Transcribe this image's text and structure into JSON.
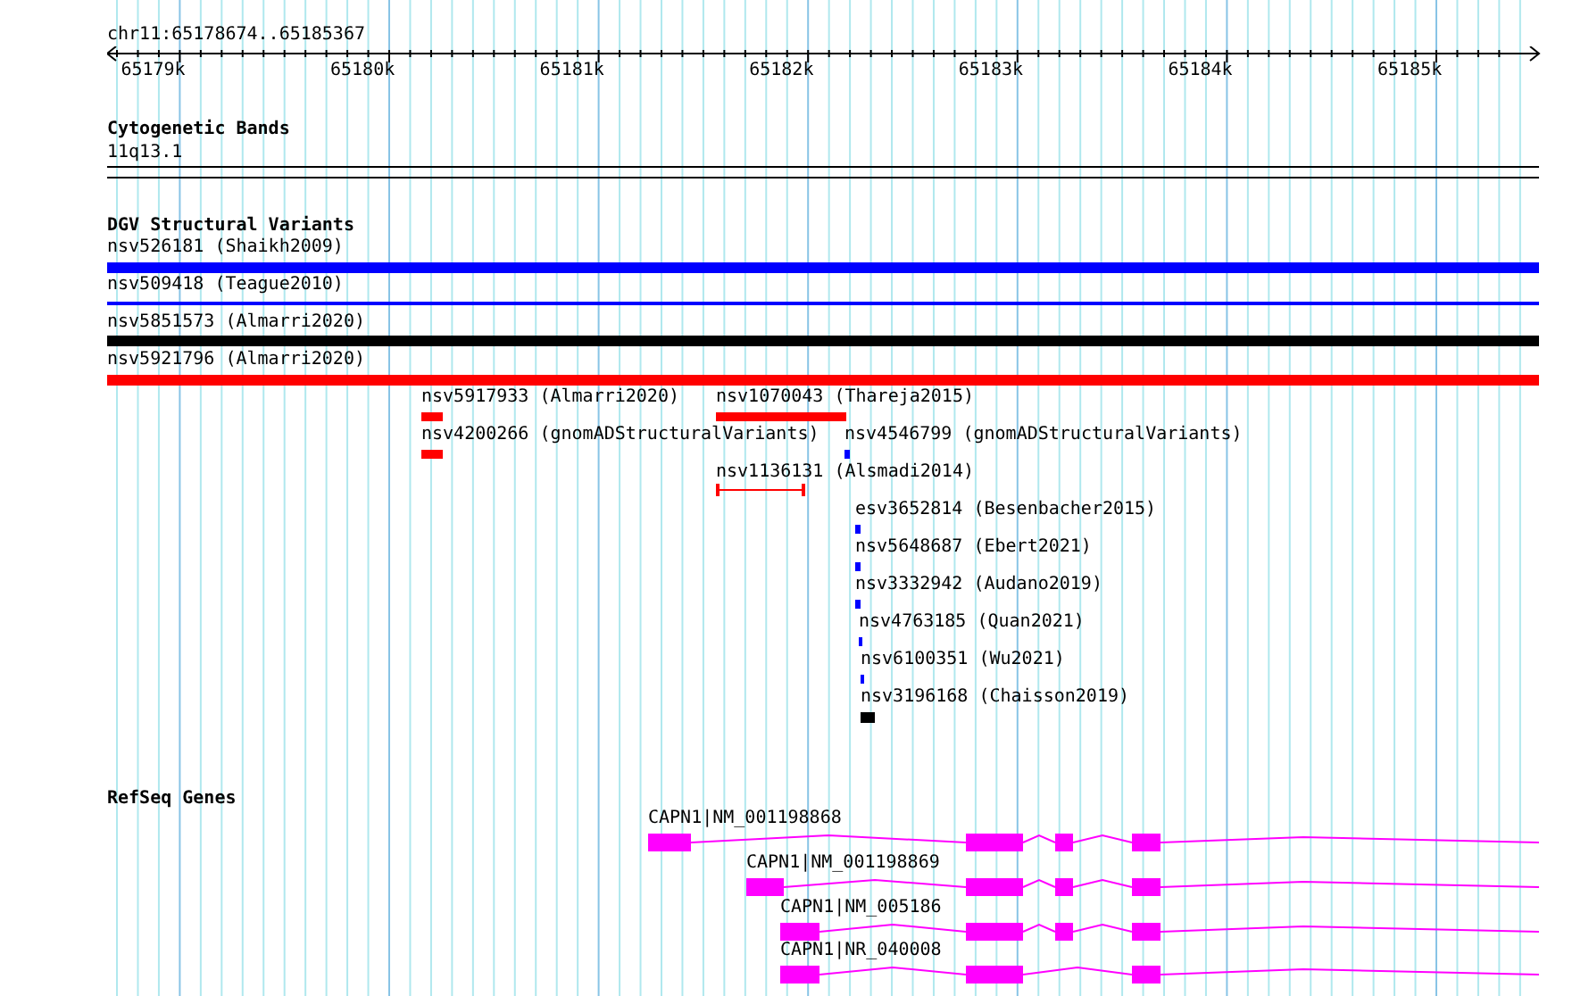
{
  "ruler": {
    "location": "chr11:65178674..65185367",
    "ticks": [
      "65179k",
      "65180k",
      "65181k",
      "65182k",
      "65183k",
      "65184k",
      "65185k"
    ]
  },
  "cytogenetic_bands": {
    "title": "Cytogenetic Bands",
    "bands": [
      {
        "label": "11q13.1"
      }
    ]
  },
  "dgv_structural_variants": {
    "title": "DGV Structural Variants",
    "features": [
      {
        "label": "nsv526181 (Shaikh2009)",
        "color": "#0000ff",
        "kind": "bar"
      },
      {
        "label": "nsv509418 (Teague2010)",
        "color": "#0000ff",
        "kind": "line"
      },
      {
        "label": "nsv5851573 (Almarri2020)",
        "color": "#000000",
        "kind": "bar"
      },
      {
        "label": "nsv5921796 (Almarri2020)",
        "color": "#ff0000",
        "kind": "bar"
      },
      {
        "label": "nsv5917933 (Almarri2020)",
        "color": "#ff0000",
        "kind": "bar"
      },
      {
        "label": "nsv1070043 (Thareja2015)",
        "color": "#ff0000",
        "kind": "bar"
      },
      {
        "label": "nsv4200266 (gnomADStructuralVariants)",
        "color": "#ff0000",
        "kind": "bar"
      },
      {
        "label": "nsv4546799 (gnomADStructuralVariants)",
        "color": "#0000ff",
        "kind": "bar"
      },
      {
        "label": "nsv1136131 (Alsmadi2014)",
        "color": "#ff0000",
        "kind": "span"
      },
      {
        "label": "esv3652814 (Besenbacher2015)",
        "color": "#0000ff",
        "kind": "bar"
      },
      {
        "label": "nsv5648687 (Ebert2021)",
        "color": "#0000ff",
        "kind": "bar"
      },
      {
        "label": "nsv3332942 (Audano2019)",
        "color": "#0000ff",
        "kind": "bar"
      },
      {
        "label": "nsv4763185 (Quan2021)",
        "color": "#0000ff",
        "kind": "bar"
      },
      {
        "label": "nsv6100351 (Wu2021)",
        "color": "#0000ff",
        "kind": "bar"
      },
      {
        "label": "nsv3196168 (Chaisson2019)",
        "color": "#000000",
        "kind": "bar"
      }
    ]
  },
  "refseq_genes": {
    "title": "RefSeq Genes",
    "genes": [
      {
        "label": "CAPN1|NM_001198868"
      },
      {
        "label": "CAPN1|NM_001198869"
      },
      {
        "label": "CAPN1|NM_005186"
      },
      {
        "label": "CAPN1|NR_040008"
      }
    ]
  }
}
